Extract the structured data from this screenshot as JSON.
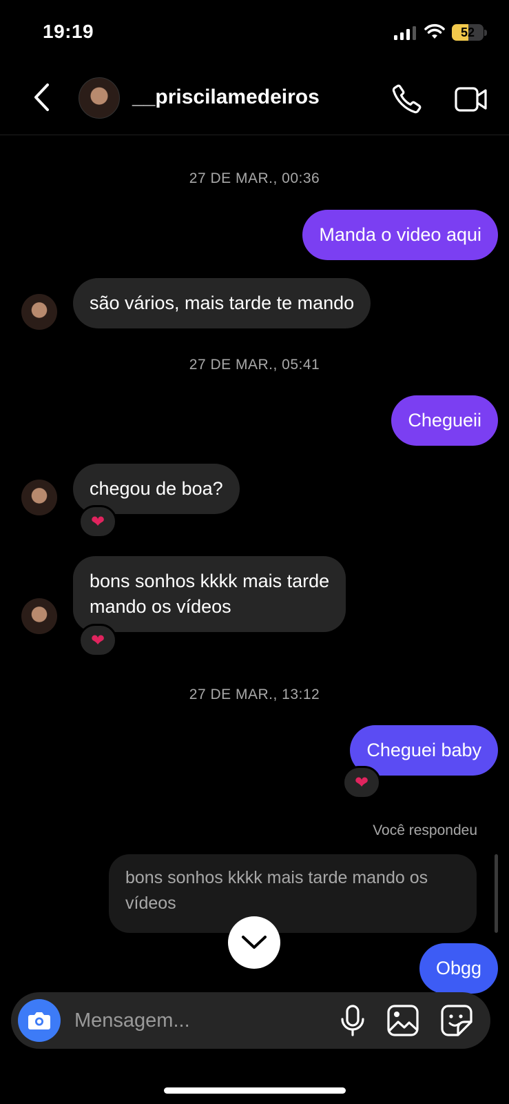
{
  "status_bar": {
    "time": "19:19",
    "battery": "52",
    "battery_level": 0.52
  },
  "header": {
    "username": "__priscilamedeiros"
  },
  "chat": {
    "timestamps": [
      "27 DE MAR., 00:36",
      "27 DE MAR., 05:41",
      "27 DE MAR., 13:12"
    ],
    "messages": [
      {
        "from": "me",
        "text": "Manda o video aqui"
      },
      {
        "from": "them",
        "text": "são vários, mais tarde te mando"
      },
      {
        "from": "me",
        "text": "Chegueii"
      },
      {
        "from": "them",
        "text": "chegou de boa?",
        "reaction": "heart"
      },
      {
        "from": "them",
        "lines": [
          "bons sonhos kkkk mais tarde",
          "mando os vídeos"
        ],
        "reaction": "heart"
      },
      {
        "from": "me",
        "text": "Cheguei baby",
        "reaction": "heart"
      },
      {
        "from": "me",
        "text": "Obgg"
      }
    ],
    "reply": {
      "label": "Você respondeu",
      "quoted_lines": [
        "bons sonhos kkkk mais tarde mando os",
        "vídeos"
      ]
    }
  },
  "composer": {
    "placeholder": "Mensagem..."
  },
  "colors": {
    "out_purple": "#7b3ff2",
    "out_indigo": "#5b4cf3",
    "out_blue": "#3d5cf5",
    "incoming": "#262626",
    "camera": "#3d7bf7"
  },
  "icons": [
    "back-arrow",
    "phone",
    "video-camera",
    "heart",
    "chevron-down",
    "camera",
    "microphone",
    "gallery",
    "sticker"
  ]
}
